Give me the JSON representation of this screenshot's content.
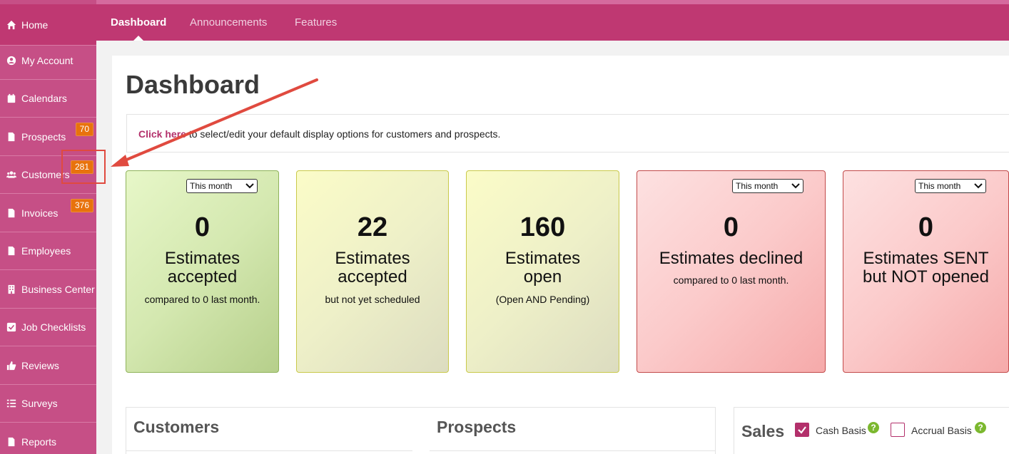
{
  "topnav": {
    "tabs": [
      {
        "label": "Dashboard",
        "active": true
      },
      {
        "label": "Announcements",
        "active": false
      },
      {
        "label": "Features",
        "active": false
      }
    ]
  },
  "sidebar": {
    "items": [
      {
        "label": "Home",
        "icon": "home-icon"
      },
      {
        "label": "My Account",
        "icon": "user-circle-icon"
      },
      {
        "label": "Calendars",
        "icon": "calendar-icon"
      },
      {
        "label": "Prospects",
        "icon": "document-icon",
        "badge": "70"
      },
      {
        "label": "Customers",
        "icon": "users-icon",
        "badge": "281"
      },
      {
        "label": "Invoices",
        "icon": "document-icon",
        "badge": "376"
      },
      {
        "label": "Employees",
        "icon": "document-icon"
      },
      {
        "label": "Business Center",
        "icon": "building-icon"
      },
      {
        "label": "Job Checklists",
        "icon": "checkbox-icon"
      },
      {
        "label": "Reviews",
        "icon": "thumbs-up-icon"
      },
      {
        "label": "Surveys",
        "icon": "list-icon"
      },
      {
        "label": "Reports",
        "icon": "document-icon"
      }
    ]
  },
  "page": {
    "title": "Dashboard",
    "notice_link": "Click here",
    "notice_text": " to select/edit your default display options for customers and prospects."
  },
  "cards": [
    {
      "select": "This month",
      "number": "0",
      "label_line1": "Estimates",
      "label_line2": "accepted",
      "sub": "compared to 0 last month."
    },
    {
      "number": "22",
      "label_line1": "Estimates",
      "label_line2": "accepted",
      "sub": "but not yet scheduled"
    },
    {
      "number": "160",
      "label_line1": "Estimates",
      "label_line2": "open",
      "sub": "(Open AND Pending)"
    },
    {
      "select": "This month",
      "number": "0",
      "label_line1": "Estimates declined",
      "sub": "compared to 0 last month."
    },
    {
      "select": "This month",
      "number": "0",
      "label_line1": "Estimates SENT",
      "label_line2": "but NOT opened"
    }
  ],
  "panels": {
    "customers_title": "Customers",
    "prospects_title": "Prospects",
    "sales_title": "Sales",
    "cash_basis_label": "Cash Basis",
    "accrual_basis_label": "Accrual Basis",
    "help_glyph": "?"
  },
  "colors": {
    "sidebar": "#c64f86",
    "topnav": "#bf3872",
    "badge": "#e8720c",
    "annotation": "#e04a3f"
  }
}
